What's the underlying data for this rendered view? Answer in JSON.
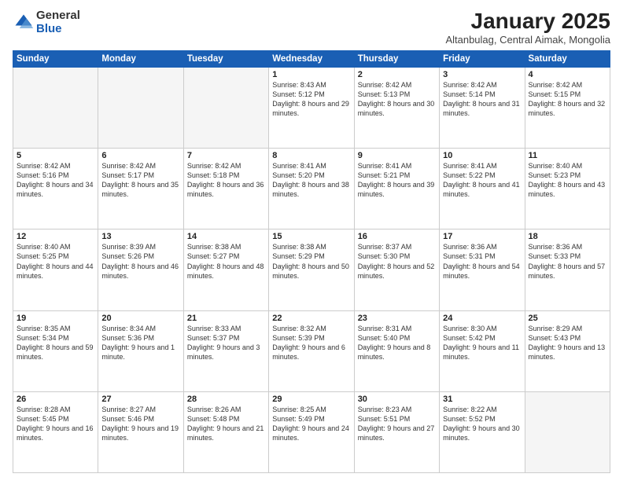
{
  "logo": {
    "general": "General",
    "blue": "Blue"
  },
  "title": "January 2025",
  "subtitle": "Altanbulag, Central Aimak, Mongolia",
  "days_header": [
    "Sunday",
    "Monday",
    "Tuesday",
    "Wednesday",
    "Thursday",
    "Friday",
    "Saturday"
  ],
  "weeks": [
    [
      {
        "num": "",
        "sunrise": "",
        "sunset": "",
        "daylight": "",
        "empty": true
      },
      {
        "num": "",
        "sunrise": "",
        "sunset": "",
        "daylight": "",
        "empty": true
      },
      {
        "num": "",
        "sunrise": "",
        "sunset": "",
        "daylight": "",
        "empty": true
      },
      {
        "num": "1",
        "sunrise": "Sunrise: 8:43 AM",
        "sunset": "Sunset: 5:12 PM",
        "daylight": "Daylight: 8 hours and 29 minutes."
      },
      {
        "num": "2",
        "sunrise": "Sunrise: 8:42 AM",
        "sunset": "Sunset: 5:13 PM",
        "daylight": "Daylight: 8 hours and 30 minutes."
      },
      {
        "num": "3",
        "sunrise": "Sunrise: 8:42 AM",
        "sunset": "Sunset: 5:14 PM",
        "daylight": "Daylight: 8 hours and 31 minutes."
      },
      {
        "num": "4",
        "sunrise": "Sunrise: 8:42 AM",
        "sunset": "Sunset: 5:15 PM",
        "daylight": "Daylight: 8 hours and 32 minutes."
      }
    ],
    [
      {
        "num": "5",
        "sunrise": "Sunrise: 8:42 AM",
        "sunset": "Sunset: 5:16 PM",
        "daylight": "Daylight: 8 hours and 34 minutes."
      },
      {
        "num": "6",
        "sunrise": "Sunrise: 8:42 AM",
        "sunset": "Sunset: 5:17 PM",
        "daylight": "Daylight: 8 hours and 35 minutes."
      },
      {
        "num": "7",
        "sunrise": "Sunrise: 8:42 AM",
        "sunset": "Sunset: 5:18 PM",
        "daylight": "Daylight: 8 hours and 36 minutes."
      },
      {
        "num": "8",
        "sunrise": "Sunrise: 8:41 AM",
        "sunset": "Sunset: 5:20 PM",
        "daylight": "Daylight: 8 hours and 38 minutes."
      },
      {
        "num": "9",
        "sunrise": "Sunrise: 8:41 AM",
        "sunset": "Sunset: 5:21 PM",
        "daylight": "Daylight: 8 hours and 39 minutes."
      },
      {
        "num": "10",
        "sunrise": "Sunrise: 8:41 AM",
        "sunset": "Sunset: 5:22 PM",
        "daylight": "Daylight: 8 hours and 41 minutes."
      },
      {
        "num": "11",
        "sunrise": "Sunrise: 8:40 AM",
        "sunset": "Sunset: 5:23 PM",
        "daylight": "Daylight: 8 hours and 43 minutes."
      }
    ],
    [
      {
        "num": "12",
        "sunrise": "Sunrise: 8:40 AM",
        "sunset": "Sunset: 5:25 PM",
        "daylight": "Daylight: 8 hours and 44 minutes."
      },
      {
        "num": "13",
        "sunrise": "Sunrise: 8:39 AM",
        "sunset": "Sunset: 5:26 PM",
        "daylight": "Daylight: 8 hours and 46 minutes."
      },
      {
        "num": "14",
        "sunrise": "Sunrise: 8:38 AM",
        "sunset": "Sunset: 5:27 PM",
        "daylight": "Daylight: 8 hours and 48 minutes."
      },
      {
        "num": "15",
        "sunrise": "Sunrise: 8:38 AM",
        "sunset": "Sunset: 5:29 PM",
        "daylight": "Daylight: 8 hours and 50 minutes."
      },
      {
        "num": "16",
        "sunrise": "Sunrise: 8:37 AM",
        "sunset": "Sunset: 5:30 PM",
        "daylight": "Daylight: 8 hours and 52 minutes."
      },
      {
        "num": "17",
        "sunrise": "Sunrise: 8:36 AM",
        "sunset": "Sunset: 5:31 PM",
        "daylight": "Daylight: 8 hours and 54 minutes."
      },
      {
        "num": "18",
        "sunrise": "Sunrise: 8:36 AM",
        "sunset": "Sunset: 5:33 PM",
        "daylight": "Daylight: 8 hours and 57 minutes."
      }
    ],
    [
      {
        "num": "19",
        "sunrise": "Sunrise: 8:35 AM",
        "sunset": "Sunset: 5:34 PM",
        "daylight": "Daylight: 8 hours and 59 minutes."
      },
      {
        "num": "20",
        "sunrise": "Sunrise: 8:34 AM",
        "sunset": "Sunset: 5:36 PM",
        "daylight": "Daylight: 9 hours and 1 minute."
      },
      {
        "num": "21",
        "sunrise": "Sunrise: 8:33 AM",
        "sunset": "Sunset: 5:37 PM",
        "daylight": "Daylight: 9 hours and 3 minutes."
      },
      {
        "num": "22",
        "sunrise": "Sunrise: 8:32 AM",
        "sunset": "Sunset: 5:39 PM",
        "daylight": "Daylight: 9 hours and 6 minutes."
      },
      {
        "num": "23",
        "sunrise": "Sunrise: 8:31 AM",
        "sunset": "Sunset: 5:40 PM",
        "daylight": "Daylight: 9 hours and 8 minutes."
      },
      {
        "num": "24",
        "sunrise": "Sunrise: 8:30 AM",
        "sunset": "Sunset: 5:42 PM",
        "daylight": "Daylight: 9 hours and 11 minutes."
      },
      {
        "num": "25",
        "sunrise": "Sunrise: 8:29 AM",
        "sunset": "Sunset: 5:43 PM",
        "daylight": "Daylight: 9 hours and 13 minutes."
      }
    ],
    [
      {
        "num": "26",
        "sunrise": "Sunrise: 8:28 AM",
        "sunset": "Sunset: 5:45 PM",
        "daylight": "Daylight: 9 hours and 16 minutes."
      },
      {
        "num": "27",
        "sunrise": "Sunrise: 8:27 AM",
        "sunset": "Sunset: 5:46 PM",
        "daylight": "Daylight: 9 hours and 19 minutes."
      },
      {
        "num": "28",
        "sunrise": "Sunrise: 8:26 AM",
        "sunset": "Sunset: 5:48 PM",
        "daylight": "Daylight: 9 hours and 21 minutes."
      },
      {
        "num": "29",
        "sunrise": "Sunrise: 8:25 AM",
        "sunset": "Sunset: 5:49 PM",
        "daylight": "Daylight: 9 hours and 24 minutes."
      },
      {
        "num": "30",
        "sunrise": "Sunrise: 8:23 AM",
        "sunset": "Sunset: 5:51 PM",
        "daylight": "Daylight: 9 hours and 27 minutes."
      },
      {
        "num": "31",
        "sunrise": "Sunrise: 8:22 AM",
        "sunset": "Sunset: 5:52 PM",
        "daylight": "Daylight: 9 hours and 30 minutes."
      },
      {
        "num": "",
        "sunrise": "",
        "sunset": "",
        "daylight": "",
        "empty": true
      }
    ]
  ]
}
